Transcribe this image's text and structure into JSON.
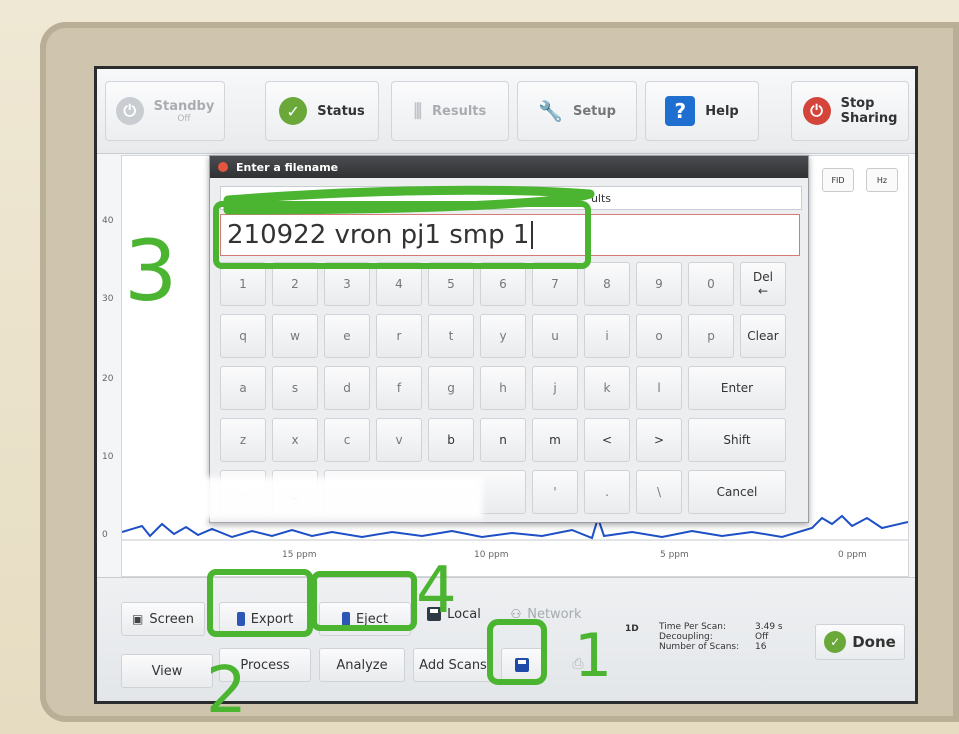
{
  "toolbar": {
    "standby": {
      "label": "Standby",
      "sub": "Off"
    },
    "status": {
      "label": "Status"
    },
    "results": {
      "label": "Results"
    },
    "setup": {
      "label": "Setup"
    },
    "help": {
      "label": "Help",
      "icon": "?"
    },
    "stop_sharing": {
      "label_line1": "Stop",
      "label_line2": "Sharing"
    }
  },
  "plot": {
    "y_ticks": [
      "40",
      "30",
      "20",
      "10",
      "0"
    ],
    "x_ticks": [
      "15 ppm",
      "10 ppm",
      "5 ppm",
      "0 ppm"
    ],
    "mode_chips": [
      "FID",
      "Hz"
    ]
  },
  "dialog": {
    "title": "Enter a filename",
    "path_text": "ults",
    "filename_value": "210922 vron pj1 smp 1",
    "keyboard": {
      "row1": [
        "1",
        "2",
        "3",
        "4",
        "5",
        "6",
        "7",
        "8",
        "9",
        "0"
      ],
      "del_label": "Del",
      "del_arrow": "←",
      "row2": [
        "q",
        "w",
        "e",
        "r",
        "t",
        "y",
        "u",
        "i",
        "o",
        "p"
      ],
      "clear_label": "Clear",
      "row3": [
        "a",
        "s",
        "d",
        "f",
        "g",
        "h",
        "j",
        "k",
        "l"
      ],
      "enter_label": "Enter",
      "row4": [
        "z",
        "x",
        "c",
        "v",
        "b",
        "n",
        "m",
        "<",
        ">"
      ],
      "shift_label": "Shift",
      "row5": [
        ".",
        "_",
        "",
        "'",
        ".",
        "\\"
      ],
      "cancel_label": "Cancel"
    }
  },
  "bottom": {
    "screen_label": "Screen",
    "export_label": "Export",
    "eject_label": "Eject",
    "local_label": "Local",
    "network_label": "Network",
    "view_label": "View",
    "process_label": "Process",
    "analyze_label": "Analyze",
    "add_scans_label": "Add Scans",
    "mode": "1D",
    "scan_info": {
      "time_per_scan_label": "Time Per Scan:",
      "time_per_scan_value": "3.49 s",
      "decoupling_label": "Decoupling:",
      "decoupling_value": "Off",
      "num_scans_label": "Number of Scans:",
      "num_scans_value": "16"
    },
    "done_label": "Done"
  },
  "annotations": [
    "3",
    "2",
    "4",
    "1"
  ],
  "colors": {
    "annotation": "#4bb531",
    "accent_green": "#6aa83a",
    "help_blue": "#1f6fd0",
    "usb_blue": "#2c57b5"
  }
}
